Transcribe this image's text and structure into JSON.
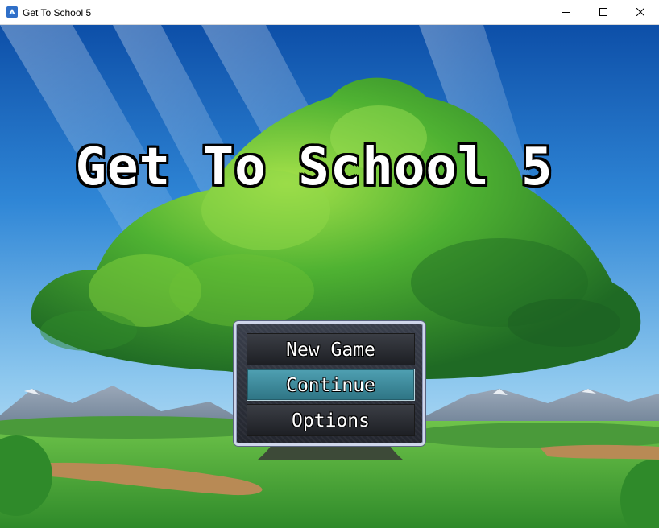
{
  "window": {
    "title": "Get To School 5",
    "icon": "rpg-maker-app-icon",
    "controls": [
      "minimize-icon",
      "maximize-icon",
      "close-icon"
    ]
  },
  "game": {
    "title": "Get To School 5",
    "menu": {
      "items": [
        {
          "label": "New Game",
          "selected": false
        },
        {
          "label": "Continue",
          "selected": true
        },
        {
          "label": "Options",
          "selected": false
        }
      ]
    }
  },
  "colors": {
    "selection": "#3b8fa0",
    "window_border": "#cfd6ea",
    "tree_foliage": "#3f9a2e",
    "sky": "#2f7fd0"
  }
}
